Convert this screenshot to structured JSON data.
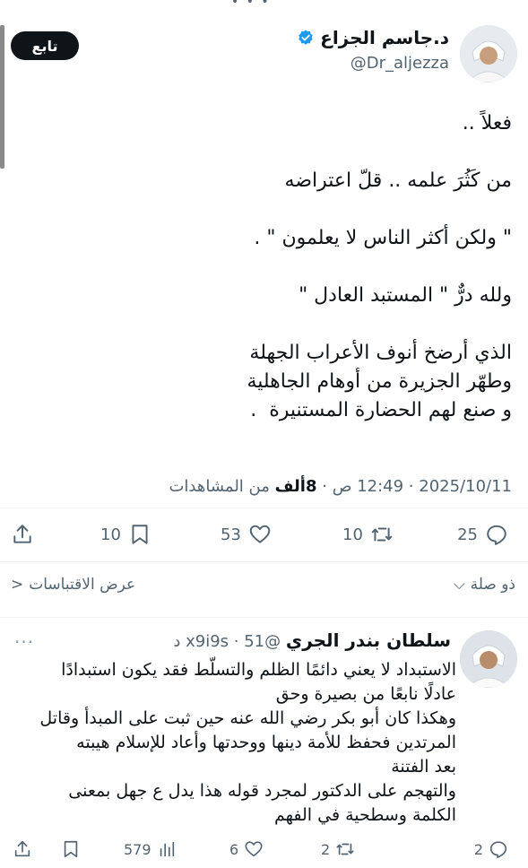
{
  "top_fragment": "• • •",
  "author": {
    "name": "د.جاسم الجزاع",
    "handle": "@Dr_aljezza",
    "follow_label": "تابع"
  },
  "tweet": {
    "lines": [
      "فعلاً ..",
      "",
      "من كَثُرَ علمه .. قلّ اعتراضه",
      "",
      "\" ولكن أكثر الناس لا يعلمون \" .",
      "",
      "ولله درٌّ \" المستبد العادل \"",
      "",
      "الذي أرضخ أنوف الأعراب الجهلة",
      "وطهّر الجزيرة من أوهام الجاهلية",
      "و صنع لهم الحضارة المستنيرة  ."
    ],
    "meta_time": "12:49 ص",
    "meta_date": "2025/10/11",
    "views_count": "8ألف",
    "views_label": "من المشاهدات",
    "stats": {
      "replies": "25",
      "retweets": "10",
      "likes": "53",
      "bookmarks": "10"
    }
  },
  "controls": {
    "relevance_label": "ذو صلة",
    "quotes_label": "عرض الاقتباسات"
  },
  "reply": {
    "name": "سلطان بندر الجري",
    "handle": "@x9i9s",
    "time": "51 د",
    "lines": [
      "الاستبداد لا يعني دائمًا الظلم والتسلّط فقد يكون استبدادًا",
      "عادلًا نابعًا من بصيرة وحق",
      "وهكذا كان أبو بكر رضي الله عنه حين ثبت على المبدأ وقاتل",
      "المرتدين فحفظ للأمة دينها ووحدتها وأعاد للإسلام هيبته",
      "بعد الفتنة",
      "والتهجم على الدكتور لمجرد قوله هذا يدل ع جهل بمعنى",
      "الكلمة وسطحية في الفهم"
    ],
    "stats": {
      "replies": "2",
      "retweets": "2",
      "likes": "6",
      "views": "579"
    }
  },
  "colors": {
    "verified": "#1d9bf0",
    "muted": "#536471",
    "text": "#0f1419"
  }
}
